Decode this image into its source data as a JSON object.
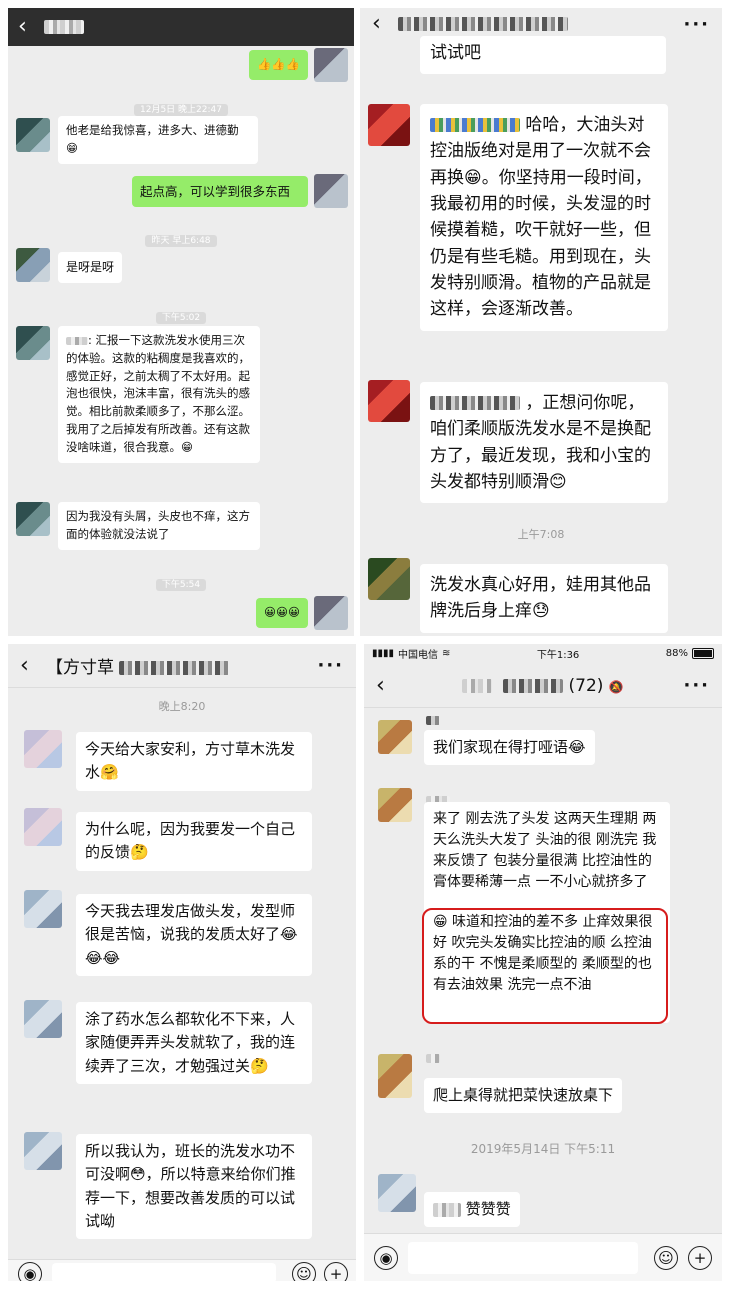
{
  "panels": {
    "p1": {
      "messages": [
        "👍👍👍",
        "12月5日 晚上22:47",
        "他老是给我惊喜，进多大、进德勤😁",
        "起点高，可以学到很多东西",
        "昨天 早上6:48",
        "是呀是呀",
        "下午5:02",
        "汇报一下这款洗发水使用三次的体验。这款的粘稠度是我喜欢的，感觉正好，之前太稠了不太好用。起泡也很快，泡沫丰富，很有洗头的感觉。相比前款柔顺多了，不那么涩。我用了之后掉发有所改善。还有这款没啥味道，很合我意。😁",
        "因为我没有头屑，头皮也不痒，这方面的体验就没法说了",
        "下午5:54",
        "😀😀😀"
      ]
    },
    "p2": {
      "messages": [
        "试试吧",
        "哈哈，大油头对控油版绝对是用了一次就不会再换😁。你坚持用一段时间，我最初用的时候，头发湿的时候摸着糙，吹干就好一些，但仍是有些毛糙。用到现在，头发特别顺滑。植物的产品就是这样，会逐渐改善。",
        "，正想问你呢，咱们柔顺版洗发水是不是换配方了，最近发现，我和小宝的头发都特别顺滑😊",
        "上午7:08",
        "洗发水真心好用，娃用其他品牌洗后身上痒😓"
      ]
    },
    "p3": {
      "title": "【方寸草",
      "messages": [
        "晚上8:20",
        "今天给大家安利，方寸草木洗发水🤗",
        "为什么呢，因为我要发一个自己的反馈🤔",
        "今天我去理发店做头发，发型师很是苦恼，说我的发质太好了😂😂😂",
        "涂了药水怎么都软化不下来，人家随便弄弄头发就软了，我的连续弄了三次，才勉强过关🤔",
        "所以我认为，班长的洗发水功不可没啊😳，所以特意来给你们推荐一下，想要改善发质的可以试试呦"
      ]
    },
    "p4": {
      "status": {
        "carrier": "中国电信",
        "time": "下午1:36",
        "battery": "88%"
      },
      "title_count": "(72)",
      "messages": [
        "我们家现在得打哑语😂",
        "来了 刚去洗了头发 这两天生理期 两天么洗头大发了 头油的很 刚洗完 我来反馈了 包装分量很满 比控油性的膏体要稀薄一点 一不小心就挤多了",
        "😁 味道和控油的差不多 止痒效果很好 吹完头发确实比控油的顺 么控油系的干 不愧是柔顺型的 柔顺型的也有去油效果 洗完一点不油",
        "爬上桌得就把菜快速放桌下",
        "2019年5月14日 下午5:11",
        "赞赞赞"
      ]
    }
  },
  "colors": {
    "green_bubble": "#95ec69",
    "highlight": "#d61c1c"
  },
  "icons": [
    "back-icon",
    "more-icon",
    "voice-icon",
    "emoji-icon",
    "plus-icon",
    "wifi-icon",
    "battery-icon",
    "mute-bell-icon"
  ]
}
